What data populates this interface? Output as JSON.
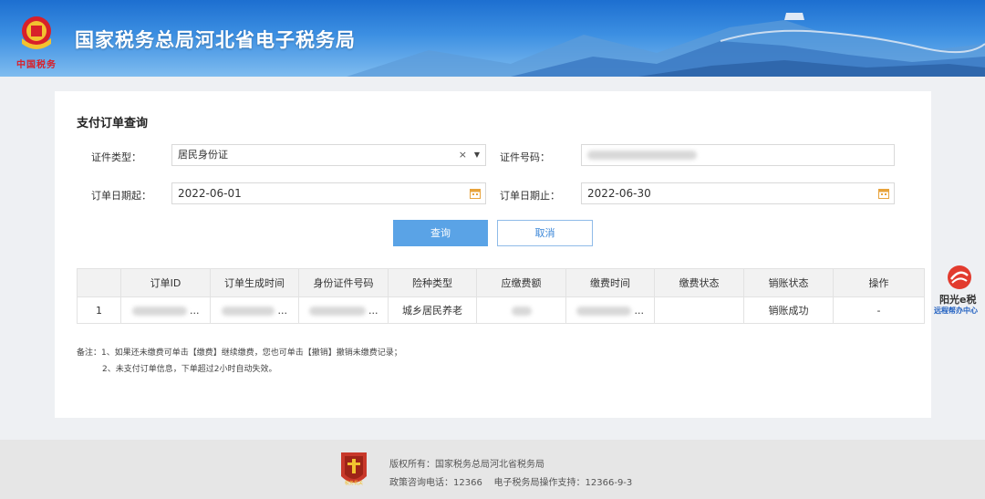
{
  "header": {
    "title": "国家税务总局河北省电子税务局",
    "logo_text": "中国税务"
  },
  "form": {
    "title": "支付订单查询",
    "id_type_label": "证件类型：",
    "id_type_value": "居民身份证",
    "clear_symbol": "×",
    "caret_symbol": "▼",
    "id_number_label": "证件号码：",
    "start_label": "订单日期起：",
    "start_value": "2022-06-01",
    "end_label": "订单日期止：",
    "end_value": "2022-06-30",
    "query_button": "查询",
    "cancel_button": "取消"
  },
  "table": {
    "columns": [
      "",
      "订单ID",
      "订单生成时间",
      "身份证件号码",
      "险种类型",
      "应缴费额",
      "缴费时间",
      "缴费状态",
      "销账状态",
      "操作"
    ],
    "rows": [
      {
        "index": "1",
        "order_suffix": "...",
        "time_suffix": "...",
        "id_suffix": "...",
        "insurance": "城乡居民养老",
        "pay_time_suffix": "...",
        "pay_status": "",
        "writeoff": "销账成功",
        "op": "-"
      }
    ]
  },
  "notes": {
    "line1": "备注：1、如果还未缴费可单击【缴费】继续缴费，您也可单击【撤销】撤销未缴费记录；",
    "line2": "2、未支付订单信息，下单超过2小时自动失效。"
  },
  "help": {
    "brand": "阳光e税",
    "sub": "远程帮办中心"
  },
  "footer": {
    "line1": "版权所有：国家税务总局河北省税务局",
    "line2": "政策咨询电话：12366    电子税务局操作支持：12366-9-3",
    "emblem_text": "税务机关"
  },
  "colors": {
    "header_blue": "#1d6fd0",
    "primary_button": "#5aa3e6",
    "calendar_icon": "#e8a33b"
  }
}
